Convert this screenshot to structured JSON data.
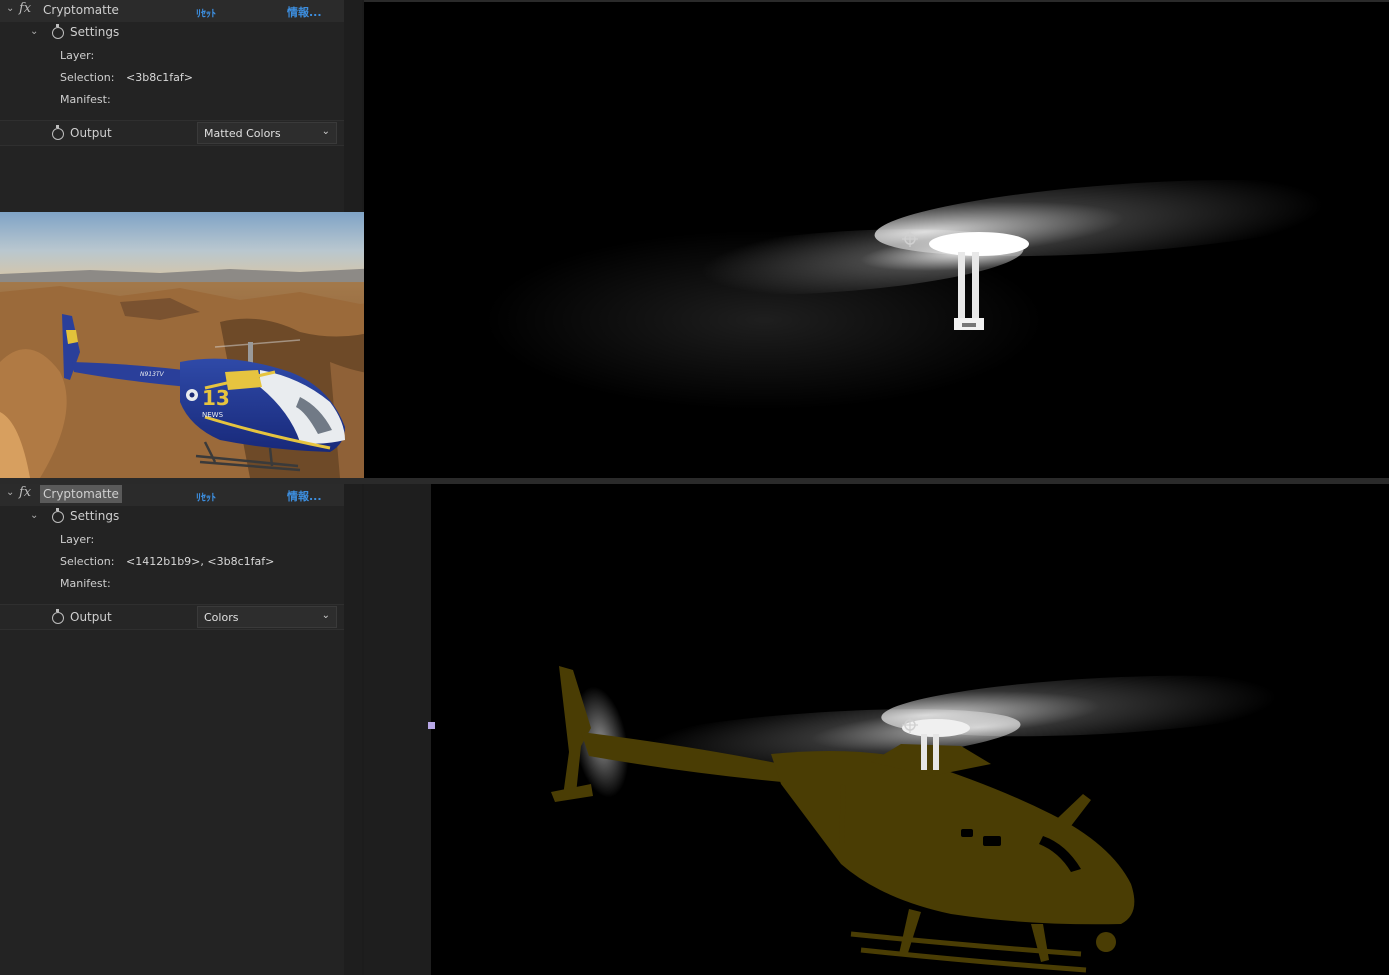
{
  "effect_top": {
    "name": "Cryptomatte",
    "reset_label": "ﾘｾｯﾄ",
    "info_label": "情報...",
    "settings_label": "Settings",
    "layer_label": "Layer:",
    "selection_label": "Selection:",
    "selection_value": "<3b8c1faf>",
    "manifest_label": "Manifest:",
    "output_label": "Output",
    "output_value": "Matted Colors"
  },
  "effect_bottom": {
    "name": "Cryptomatte",
    "reset_label": "ﾘｾｯﾄ",
    "info_label": "情報...",
    "settings_label": "Settings",
    "layer_label": "Layer:",
    "selection_label": "Selection:",
    "selection_value": "<1412b1b9>, <3b8c1faf>",
    "manifest_label": "Manifest:",
    "output_label": "Output",
    "output_value": "Colors"
  },
  "helicopter_decals": {
    "registration": "N913TV",
    "number": "13",
    "word": "NEWS"
  },
  "colors": {
    "link": "#3d8fe0",
    "matte_tint": "#4a3d04",
    "panel_bg": "#232323"
  },
  "icons": [
    "fx-icon",
    "stopwatch-icon",
    "chevron-down-icon",
    "anchor-point-icon"
  ]
}
